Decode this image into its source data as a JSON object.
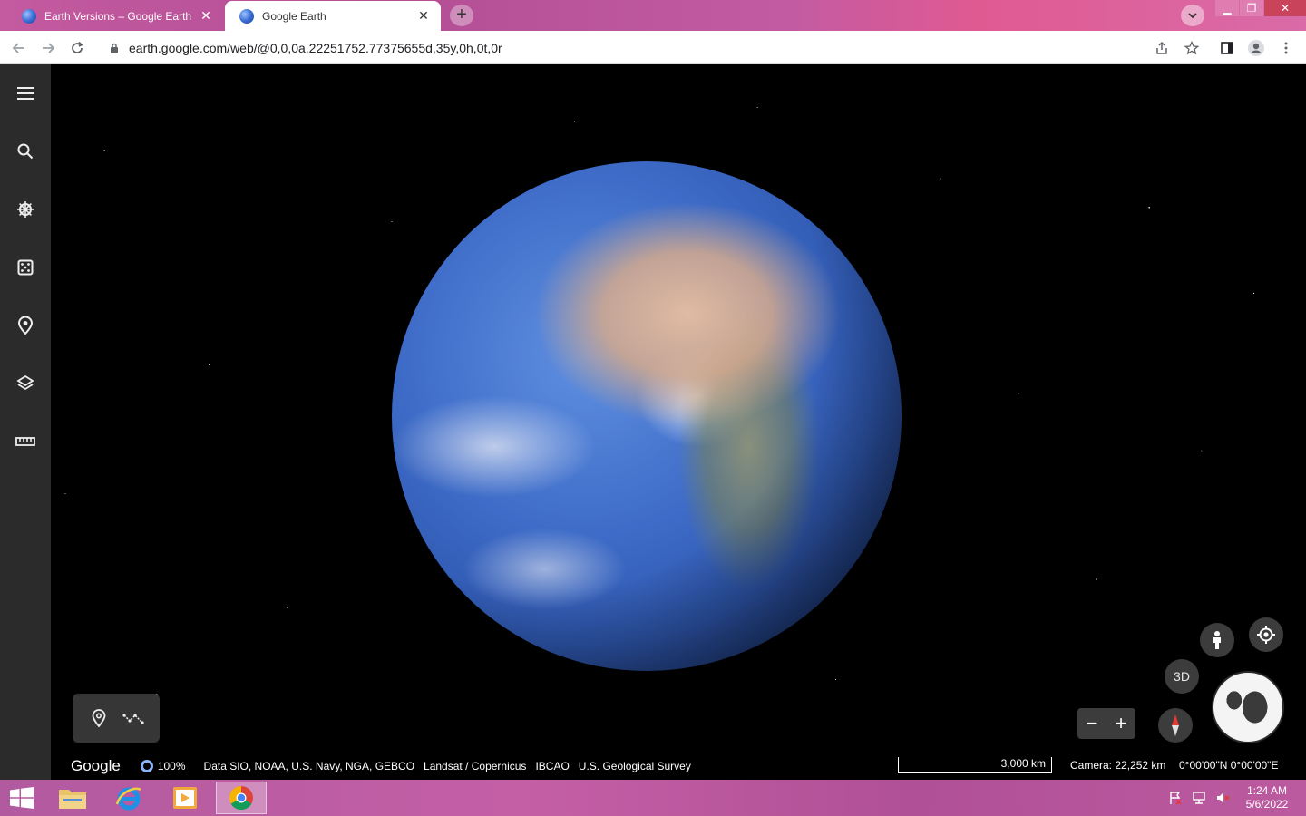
{
  "browser": {
    "tabs": [
      {
        "title": "Earth Versions – Google Earth",
        "active": false
      },
      {
        "title": "Google Earth",
        "active": true
      }
    ],
    "new_tab_label": "+",
    "url": "earth.google.com/web/@0,0,0a,22251752.77375655d,35y,0h,0t,0r"
  },
  "earth": {
    "view_mode_label": "3D",
    "logo": "Google",
    "loading_percent": "100%",
    "attribution": "Data SIO, NOAA, U.S. Navy, NGA, GEBCO   Landsat / Copernicus   IBCAO   U.S. Geological Survey",
    "scale_label": "3,000 km",
    "camera": "Camera: 22,252 km",
    "coordinates": "0°00'00\"N 0°00'00\"E",
    "zoom_out_label": "−",
    "zoom_in_label": "+"
  },
  "taskbar": {
    "time": "1:24 AM",
    "date": "5/6/2022"
  },
  "colors": {
    "rail": "#2b2b2b",
    "accent": "#8ab4f8",
    "tab_gradient": "#c45aa0"
  }
}
